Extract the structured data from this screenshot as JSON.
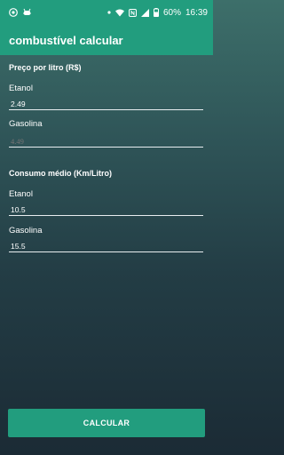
{
  "status_bar": {
    "battery": "60%",
    "time": "16:39",
    "left_icons": [
      "chrome-icon",
      "android-debug-icon"
    ],
    "right_icons": [
      "dot-icon",
      "wifi-icon",
      "nfc-icon",
      "signal-icon",
      "battery-icon"
    ]
  },
  "app_bar": {
    "title": "combustível calcular"
  },
  "price_section": {
    "title": "Preço por litro (R$)",
    "ethanol_label": "Etanol",
    "ethanol_value": "2.49",
    "gasoline_label": "Gasolina",
    "gasoline_placeholder": "4.49"
  },
  "consumption_section": {
    "title": "Consumo médio (Km/Litro)",
    "ethanol_label": "Etanol",
    "ethanol_value": "10.5",
    "gasoline_label": "Gasolina",
    "gasoline_value": "15.5"
  },
  "calculate_button": {
    "label": "CALCULAR"
  },
  "colors": {
    "accent": "#229d7e",
    "background_top": "#3d6f6a",
    "background_bottom": "#1b2b35"
  }
}
